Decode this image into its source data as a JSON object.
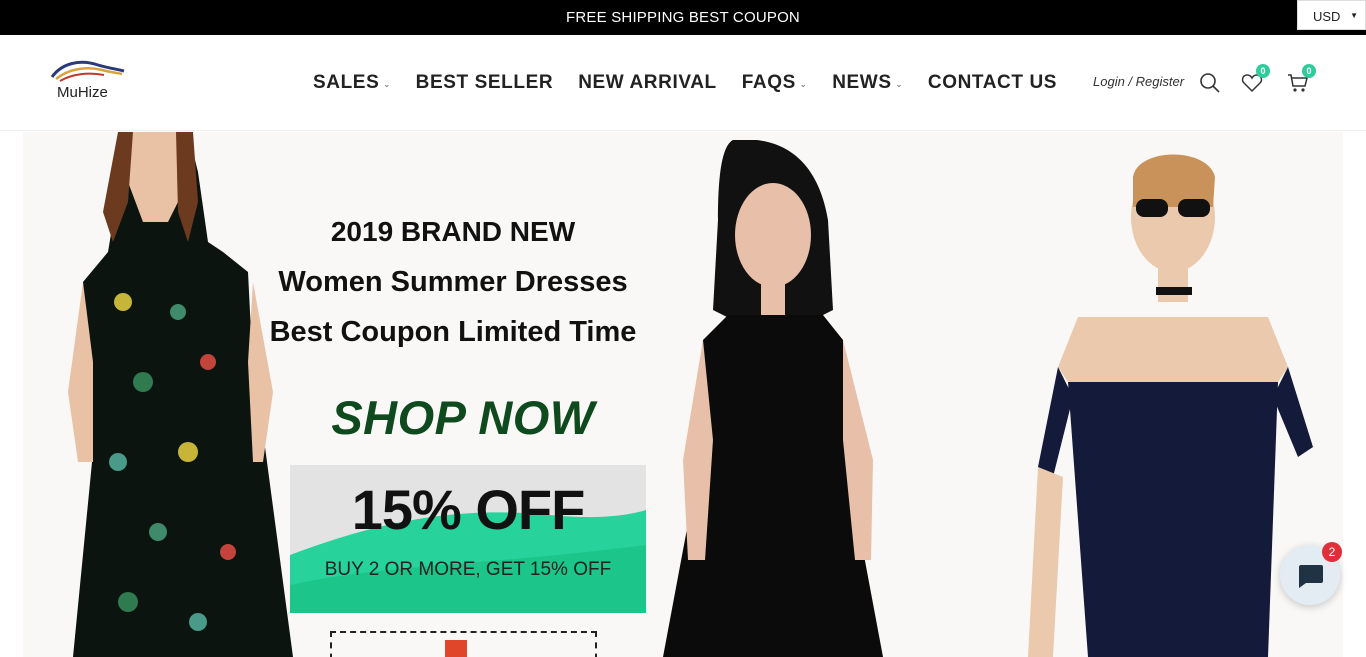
{
  "topbar": {
    "message": "FREE SHIPPING BEST COUPON",
    "currency": "USD"
  },
  "header": {
    "logo_text": "MuHize",
    "nav": [
      {
        "label": "SALES",
        "has_dropdown": true
      },
      {
        "label": "BEST SELLER",
        "has_dropdown": false
      },
      {
        "label": "NEW ARRIVAL",
        "has_dropdown": false
      },
      {
        "label": "FAQS",
        "has_dropdown": true
      },
      {
        "label": "NEWS",
        "has_dropdown": true
      },
      {
        "label": "CONTACT US",
        "has_dropdown": false
      }
    ],
    "login_label": "Login / Register",
    "wishlist_count": "0",
    "cart_count": "0",
    "icons": [
      "search-icon",
      "heart-icon",
      "cart-icon"
    ]
  },
  "hero": {
    "line1": "2019 BRAND NEW",
    "line2": "Women Summer Dresses",
    "line3": "Best Coupon Limited Time",
    "cta": "SHOP NOW",
    "discount": "15% OFF",
    "discount_sub": "BUY 2 OR MORE, GET 15% OFF"
  },
  "chat": {
    "unread": "2"
  },
  "colors": {
    "accent_badge": "#2ecc9a",
    "cta_green": "#0f4a1e",
    "chat_badge": "#e02e3a",
    "topbar_bg": "#000000"
  }
}
